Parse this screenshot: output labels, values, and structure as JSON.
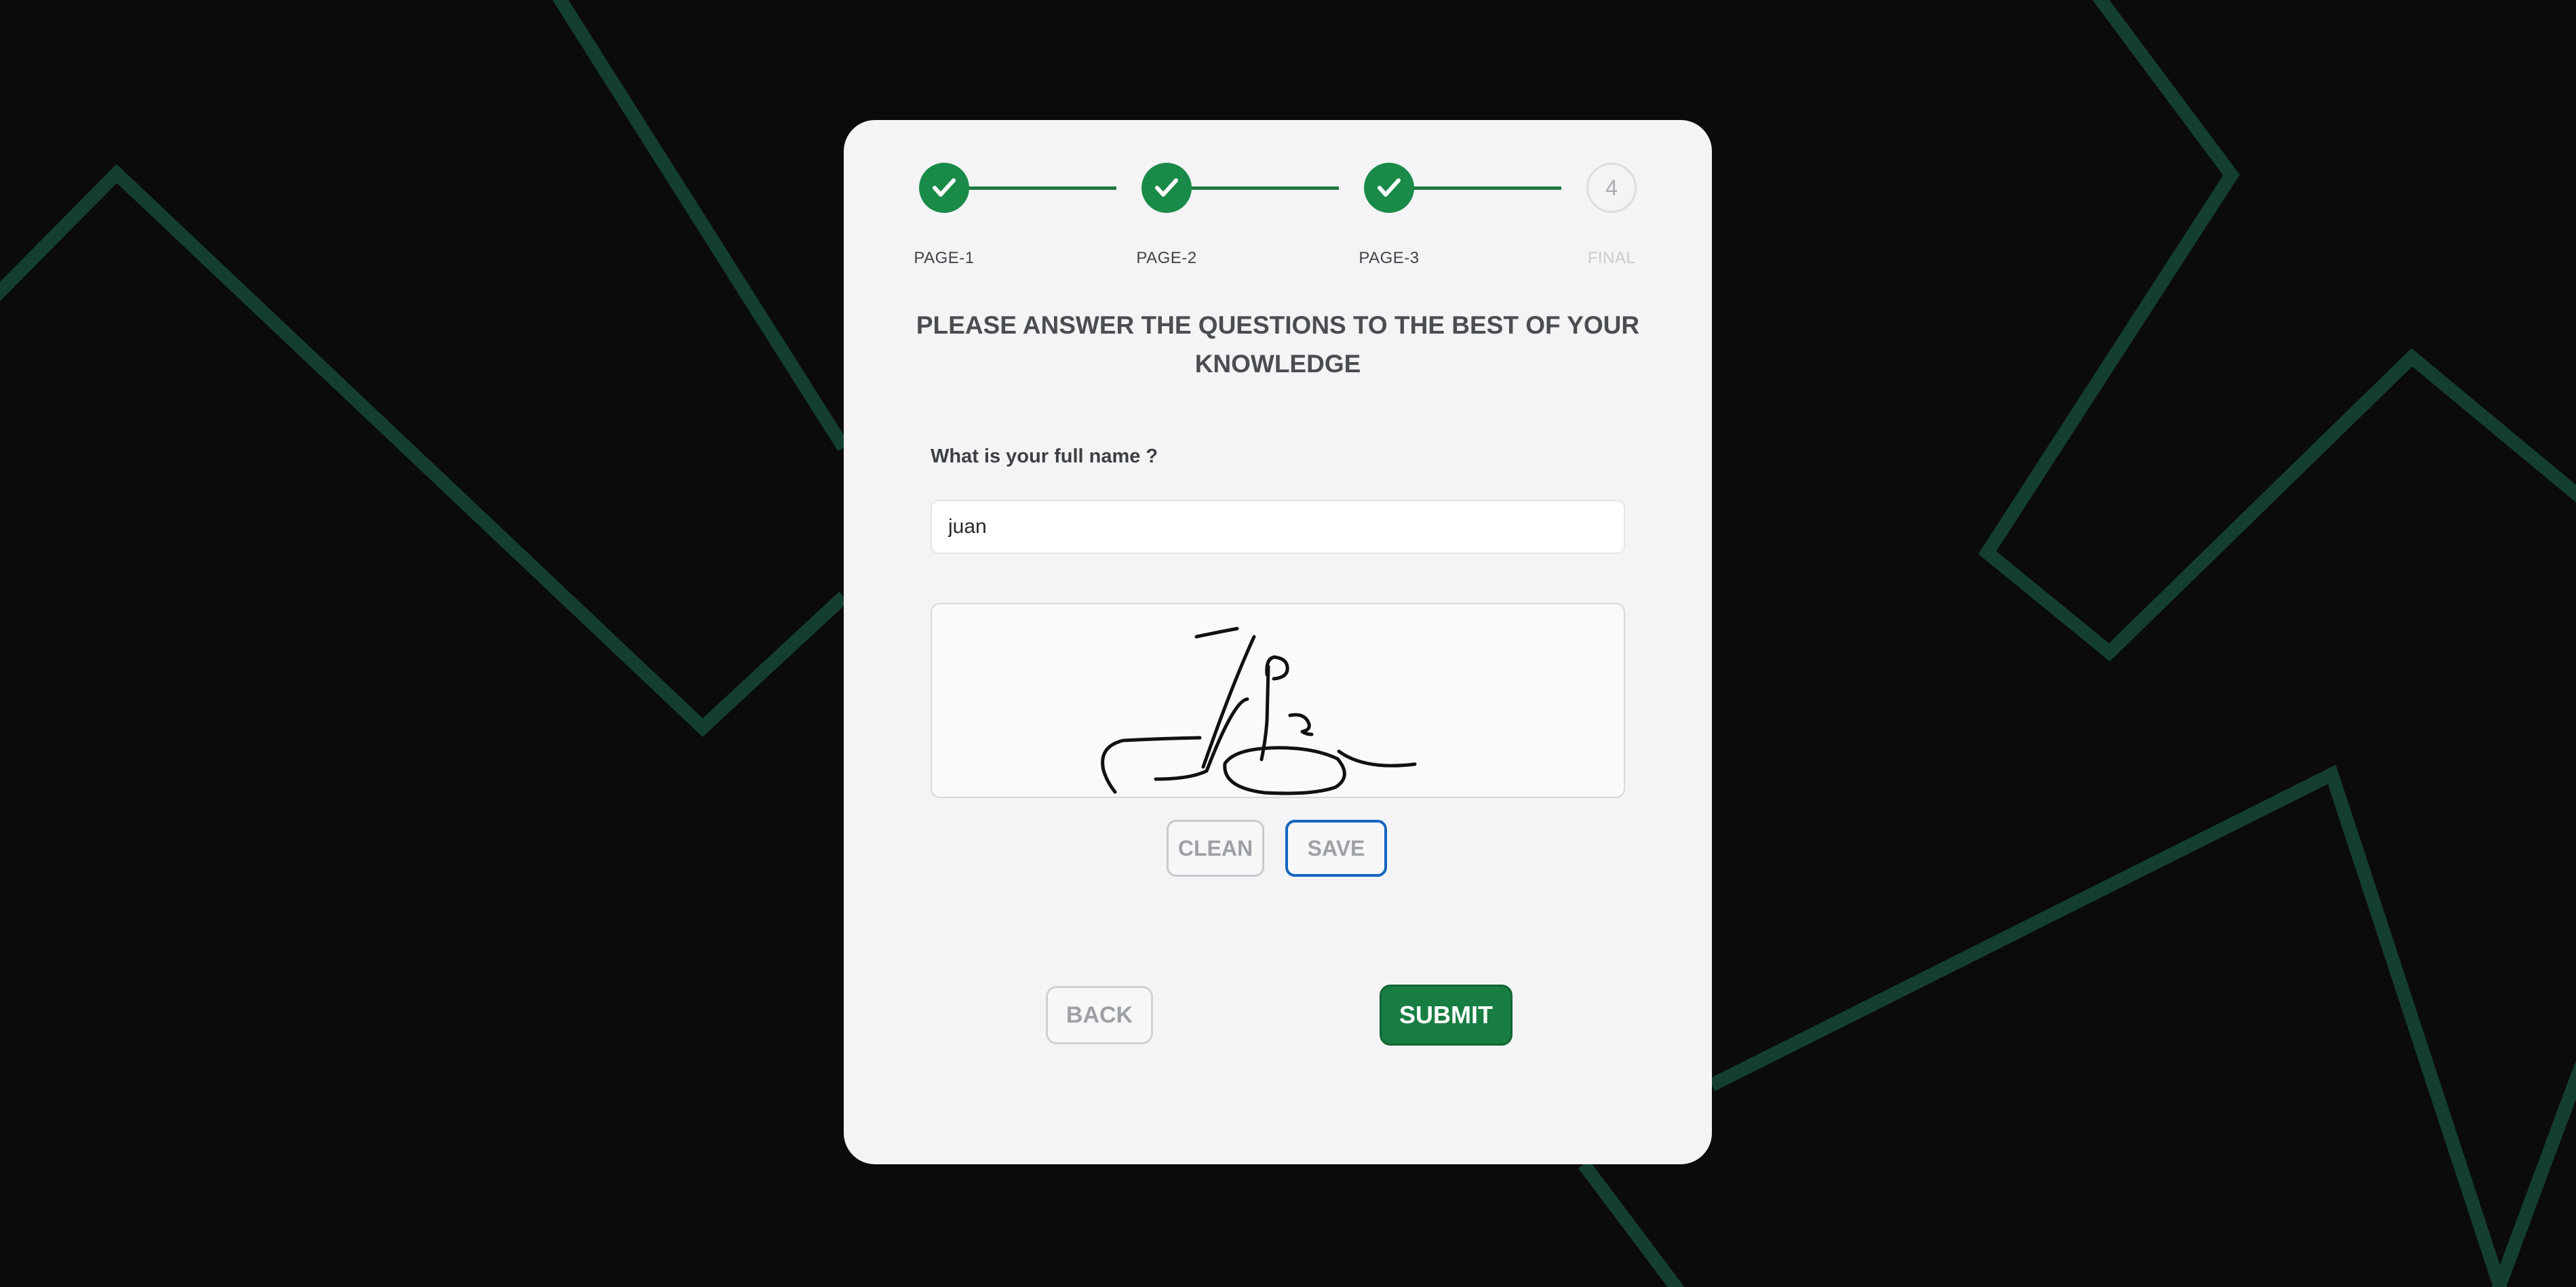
{
  "stepper": {
    "steps": [
      {
        "label": "PAGE-1",
        "status": "complete",
        "number": "1"
      },
      {
        "label": "PAGE-2",
        "status": "complete",
        "number": "2"
      },
      {
        "label": "PAGE-3",
        "status": "complete",
        "number": "3"
      },
      {
        "label": "FINAL",
        "status": "pending",
        "number": "4"
      }
    ]
  },
  "form": {
    "heading": "PLEASE ANSWER THE QUESTIONS TO THE BEST OF YOUR KNOWLEDGE",
    "question": "What is your full name ?",
    "name_value": "juan"
  },
  "signature": {
    "clean_label": "CLEAN",
    "save_label": "SAVE"
  },
  "nav": {
    "back_label": "BACK",
    "submit_label": "SUBMIT"
  },
  "colors": {
    "background": "#0b0b0b",
    "background_lines": "#143f2f",
    "card": "#f4f4f6",
    "step_complete": "#1a8a48",
    "submit": "#187d42",
    "save_border": "#1565c0"
  }
}
